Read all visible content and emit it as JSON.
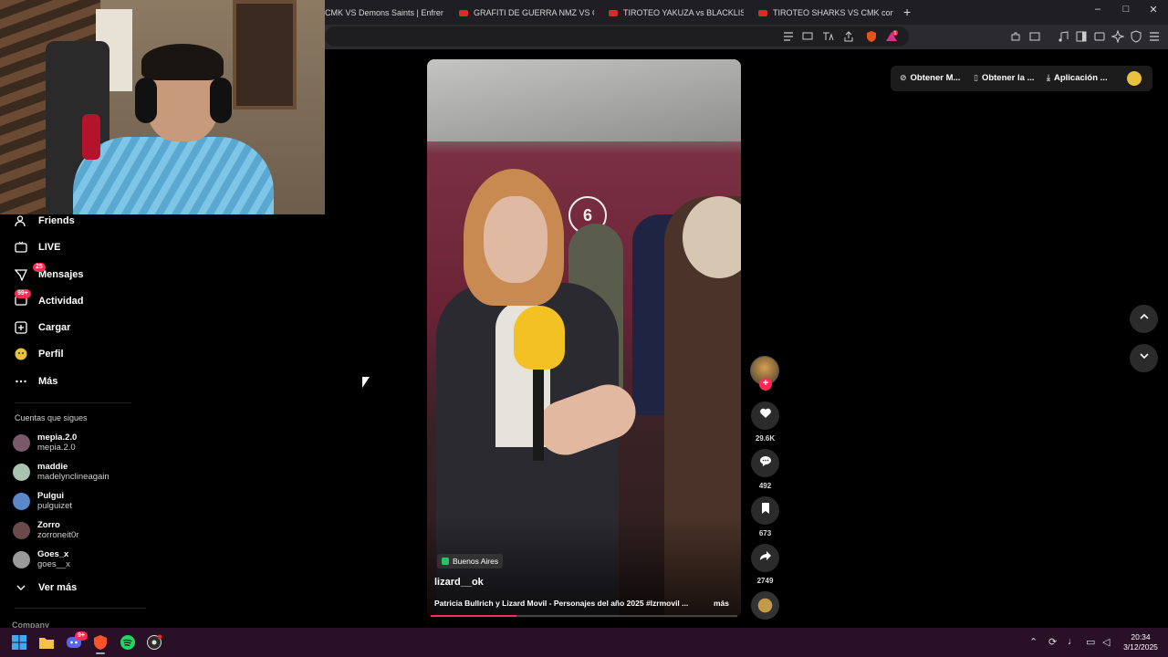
{
  "browser": {
    "tabs": [
      {
        "label": "CMK VS Demons Saints | Enfrentamien",
        "has_icon": false
      },
      {
        "label": "GRAFITI DE GUERRA NMZ VS CMK | E",
        "has_icon": true
      },
      {
        "label": "TIROTEO YAKUZA vs BLACKLIST | GRA",
        "has_icon": true
      },
      {
        "label": "TIROTEO SHARKS VS CMK con ARMA",
        "has_icon": true
      }
    ],
    "new_tab": "+",
    "window_controls": {
      "minimize": "–",
      "maximize": "□",
      "close": "✕"
    },
    "extension_badge": "1"
  },
  "sidebar": {
    "items": [
      {
        "label": "Friends",
        "icon": "friends-icon"
      },
      {
        "label": "LIVE",
        "icon": "live-icon"
      },
      {
        "label": "Mensajes",
        "icon": "messages-icon",
        "badge": "25"
      },
      {
        "label": "Actividad",
        "icon": "activity-icon",
        "badge": "99+"
      },
      {
        "label": "Cargar",
        "icon": "upload-icon"
      },
      {
        "label": "Perfil",
        "icon": "profile-icon"
      },
      {
        "label": "Más",
        "icon": "more-icon"
      }
    ],
    "following_title": "Cuentas que sigues",
    "accounts": [
      {
        "name": "mepia.2.0",
        "username": "mepia.2.0",
        "color": "#7a5a6a"
      },
      {
        "name": "maddie",
        "username": "madelynclineagain",
        "color": "#a8c4b0"
      },
      {
        "name": "Pulgui",
        "username": "pulguizet",
        "color": "#5a88c8"
      },
      {
        "name": "Zorro",
        "username": "zorroneit0r",
        "color": "#6a4a4a"
      },
      {
        "name": "Goes_x",
        "username": "goes__x",
        "color": "#9a9a9a"
      }
    ],
    "see_more": "Ver más",
    "company": "Company"
  },
  "video": {
    "location": "Buenos Aires",
    "author": "lizard__ok",
    "caption": "Patricia Bullrich y Lizard Movil - Personajes del año 2025 #lzrmovil ...",
    "more": "más",
    "progress": 0.28
  },
  "actions": {
    "likes": "29.6K",
    "comments": "492",
    "saves": "673",
    "shares": "2749",
    "follow": "+"
  },
  "top_actions": {
    "get_coins": "Obtener M...",
    "get_app": "Obtener la ...",
    "desktop_app": "Aplicación ..."
  },
  "taskbar": {
    "time": "20:34",
    "date": "3/12/2025",
    "discord_badge": "9+"
  },
  "colors": {
    "accent": "#fe2c55",
    "taskbar": "#2a1026"
  }
}
